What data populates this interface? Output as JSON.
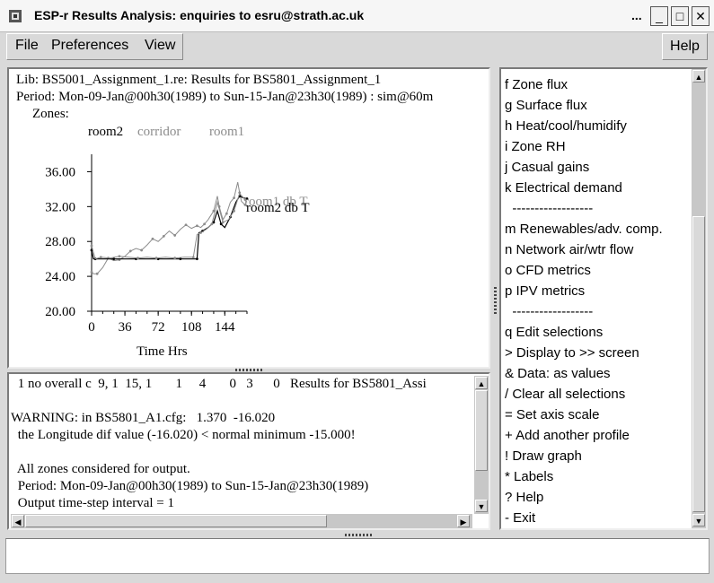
{
  "window": {
    "title": "ESP-r Results Analysis: enquiries to esru@strath.ac.uk",
    "dots": "...",
    "minimize": "_",
    "maximize": "□",
    "close": "✕"
  },
  "menubar": {
    "file": "File",
    "preferences": "Preferences",
    "view": "View",
    "help": "Help"
  },
  "graph": {
    "lib_line": "Lib: BS5001_Assignment_1.re: Results for BS5801_Assignment_1",
    "period_line": "Period: Mon-09-Jan@00h30(1989) to Sun-15-Jan@23h30(1989) : sim@60m",
    "zones_label": "Zones:",
    "zones": [
      {
        "name": "room2",
        "color": "#000000"
      },
      {
        "name": "corridor",
        "color": "#8c8c8c"
      },
      {
        "name": "room1",
        "color": "#8c8c8c"
      }
    ],
    "xlabel": "Time Hrs",
    "series_label_1": "room1 db T",
    "series_label_2": "room2 db T"
  },
  "chart_data": {
    "type": "line",
    "xlabel": "Time Hrs",
    "ylabel": "",
    "xticks": [
      0,
      36,
      72,
      108,
      144
    ],
    "yticks": [
      "20.00",
      "24.00",
      "28.00",
      "32.00",
      "36.00"
    ],
    "xlim": [
      0,
      168
    ],
    "ylim": [
      20,
      38
    ],
    "series": [
      {
        "name": "room1 db T",
        "color": "#8c8c8c",
        "x": [
          0,
          2,
          6,
          12,
          18,
          24,
          30,
          36,
          42,
          48,
          54,
          60,
          66,
          72,
          78,
          84,
          90,
          96,
          102,
          108,
          114,
          118,
          122,
          126,
          132,
          136,
          138,
          142,
          146,
          150,
          154,
          158,
          160,
          162,
          166,
          168
        ],
        "y": [
          24.5,
          24.3,
          24.3,
          25.0,
          26.1,
          25.8,
          25.9,
          26.3,
          26.9,
          27.2,
          27.0,
          27.6,
          28.3,
          28.0,
          28.6,
          29.2,
          28.7,
          29.4,
          29.9,
          29.5,
          29.8,
          29.6,
          30.0,
          30.5,
          31.5,
          33.2,
          32.0,
          30.5,
          31.2,
          32.5,
          33.0,
          34.8,
          33.6,
          32.6,
          32.2,
          32.0
        ]
      },
      {
        "name": "room2 db T",
        "color": "#000000",
        "x": [
          0,
          2,
          4,
          12,
          24,
          36,
          48,
          60,
          72,
          84,
          96,
          108,
          114,
          116,
          120,
          126,
          132,
          136,
          140,
          144,
          150,
          156,
          160,
          164,
          168
        ],
        "y": [
          27.0,
          26.0,
          26.0,
          26.0,
          26.0,
          26.0,
          26.0,
          26.0,
          26.0,
          26.0,
          26.0,
          26.0,
          26.0,
          29.0,
          29.2,
          29.6,
          30.2,
          31.5,
          30.0,
          29.6,
          30.8,
          32.5,
          33.2,
          33.0,
          32.9
        ]
      },
      {
        "name": "corridor",
        "color": "#8c8c8c",
        "x": [
          0,
          4,
          10,
          20,
          30,
          40,
          50,
          60,
          70,
          80,
          90,
          100,
          110,
          114,
          118,
          124,
          130,
          136,
          142,
          148,
          154,
          160,
          166,
          168
        ],
        "y": [
          27.5,
          26.0,
          26.2,
          26.1,
          26.3,
          26.2,
          26.1,
          26.2,
          26.1,
          26.2,
          26.1,
          26.2,
          26.2,
          28.8,
          29.0,
          29.4,
          30.0,
          32.5,
          30.2,
          30.5,
          31.5,
          33.5,
          32.8,
          32.5
        ]
      }
    ],
    "grid": false,
    "legend": "inline"
  },
  "output_text": {
    "lines": [
      " 1 no overall c  9, 1  15, 1       1     4       0   3      0   Results for BS5801_Assi",
      "",
      "WARNING: in BS5801_A1.cfg:   1.370  -16.020",
      " the Longitude dif value (-16.020) < normal minimum -15.000!",
      "",
      " All zones considered for output.",
      " Period: Mon-09-Jan@00h30(1989) to Sun-15-Jan@23h30(1989)",
      " Output time-step interval = 1"
    ]
  },
  "menu_items": [
    "f Zone flux",
    "g Surface flux",
    "h Heat/cool/humidify",
    "i Zone RH",
    "j Casual gains",
    "k Electrical demand",
    "  ------------------",
    "m Renewables/adv. comp.",
    "n Network air/wtr flow",
    "o CFD metrics",
    "p IPV metrics",
    "  ------------------",
    "q Edit selections",
    "> Display to >> screen",
    "& Data: as values",
    "/ Clear all selections",
    "= Set axis scale",
    "+ Add another profile",
    "! Draw graph",
    "* Labels",
    "? Help",
    "- Exit"
  ],
  "status_input": {
    "value": ""
  }
}
